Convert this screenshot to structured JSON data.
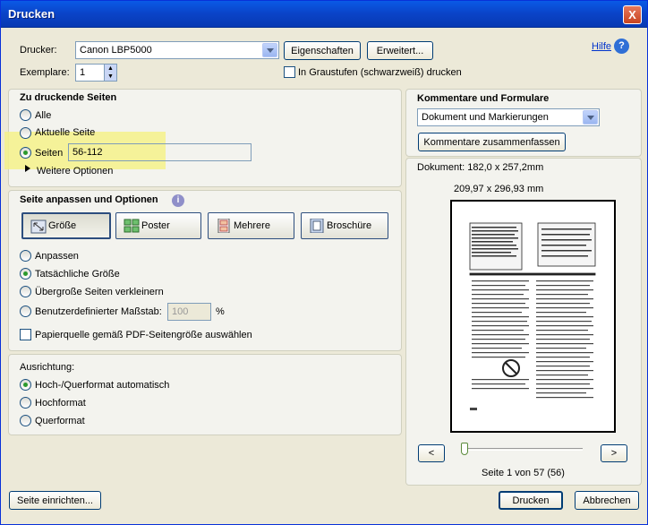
{
  "window": {
    "title": "Drucken",
    "close_symbol": "X"
  },
  "printer": {
    "label": "Drucker:",
    "value": "Canon LBP5000",
    "properties_button": "Eigenschaften",
    "advanced_button": "Erweitert...",
    "help_link": "Hilfe",
    "copies_label": "Exemplare:",
    "copies_value": "1",
    "grayscale_label": "In Graustufen (schwarzweiß) drucken",
    "grayscale_checked": false
  },
  "pages_section": {
    "title": "Zu druckende Seiten",
    "options": [
      "Alle",
      "Aktuelle Seite",
      "Seiten"
    ],
    "selected": "Seiten",
    "pages_value": "56-112",
    "more_options": "Weitere Optionen"
  },
  "fit_section": {
    "title": "Seite anpassen und Optionen",
    "buttons": [
      "Größe",
      "Poster",
      "Mehrere",
      "Broschüre"
    ],
    "active_button": "Größe",
    "options": [
      "Anpassen",
      "Tatsächliche Größe",
      "Übergroße Seiten verkleinern",
      "Benutzerdefinierter Maßstab:"
    ],
    "selected": "Tatsächliche Größe",
    "scale_value": "100",
    "scale_unit": "%",
    "paper_source_label": "Papierquelle gemäß PDF-Seitengröße auswählen"
  },
  "orientation": {
    "title": "Ausrichtung:",
    "options": [
      "Hoch-/Querformat automatisch",
      "Hochformat",
      "Querformat"
    ],
    "selected": "Hoch-/Querformat automatisch"
  },
  "comments": {
    "title": "Kommentare und Formulare",
    "select_value": "Dokument und Markierungen",
    "summarize_button": "Kommentare zusammenfassen"
  },
  "preview": {
    "document_size": "Dokument: 182,0 x 257,2mm",
    "paper_size": "209,97 x 296,93 mm",
    "prev_button": "<",
    "next_button": ">",
    "page_info": "Seite 1 von 57 (56)",
    "slider_position": 0.03
  },
  "footer": {
    "page_setup": "Seite einrichten...",
    "print": "Drucken",
    "cancel": "Abbrechen"
  },
  "colors": {
    "titlebar": "#0a43c7",
    "highlight": "#f4f18a",
    "help_icon": "#2f6fd6"
  }
}
